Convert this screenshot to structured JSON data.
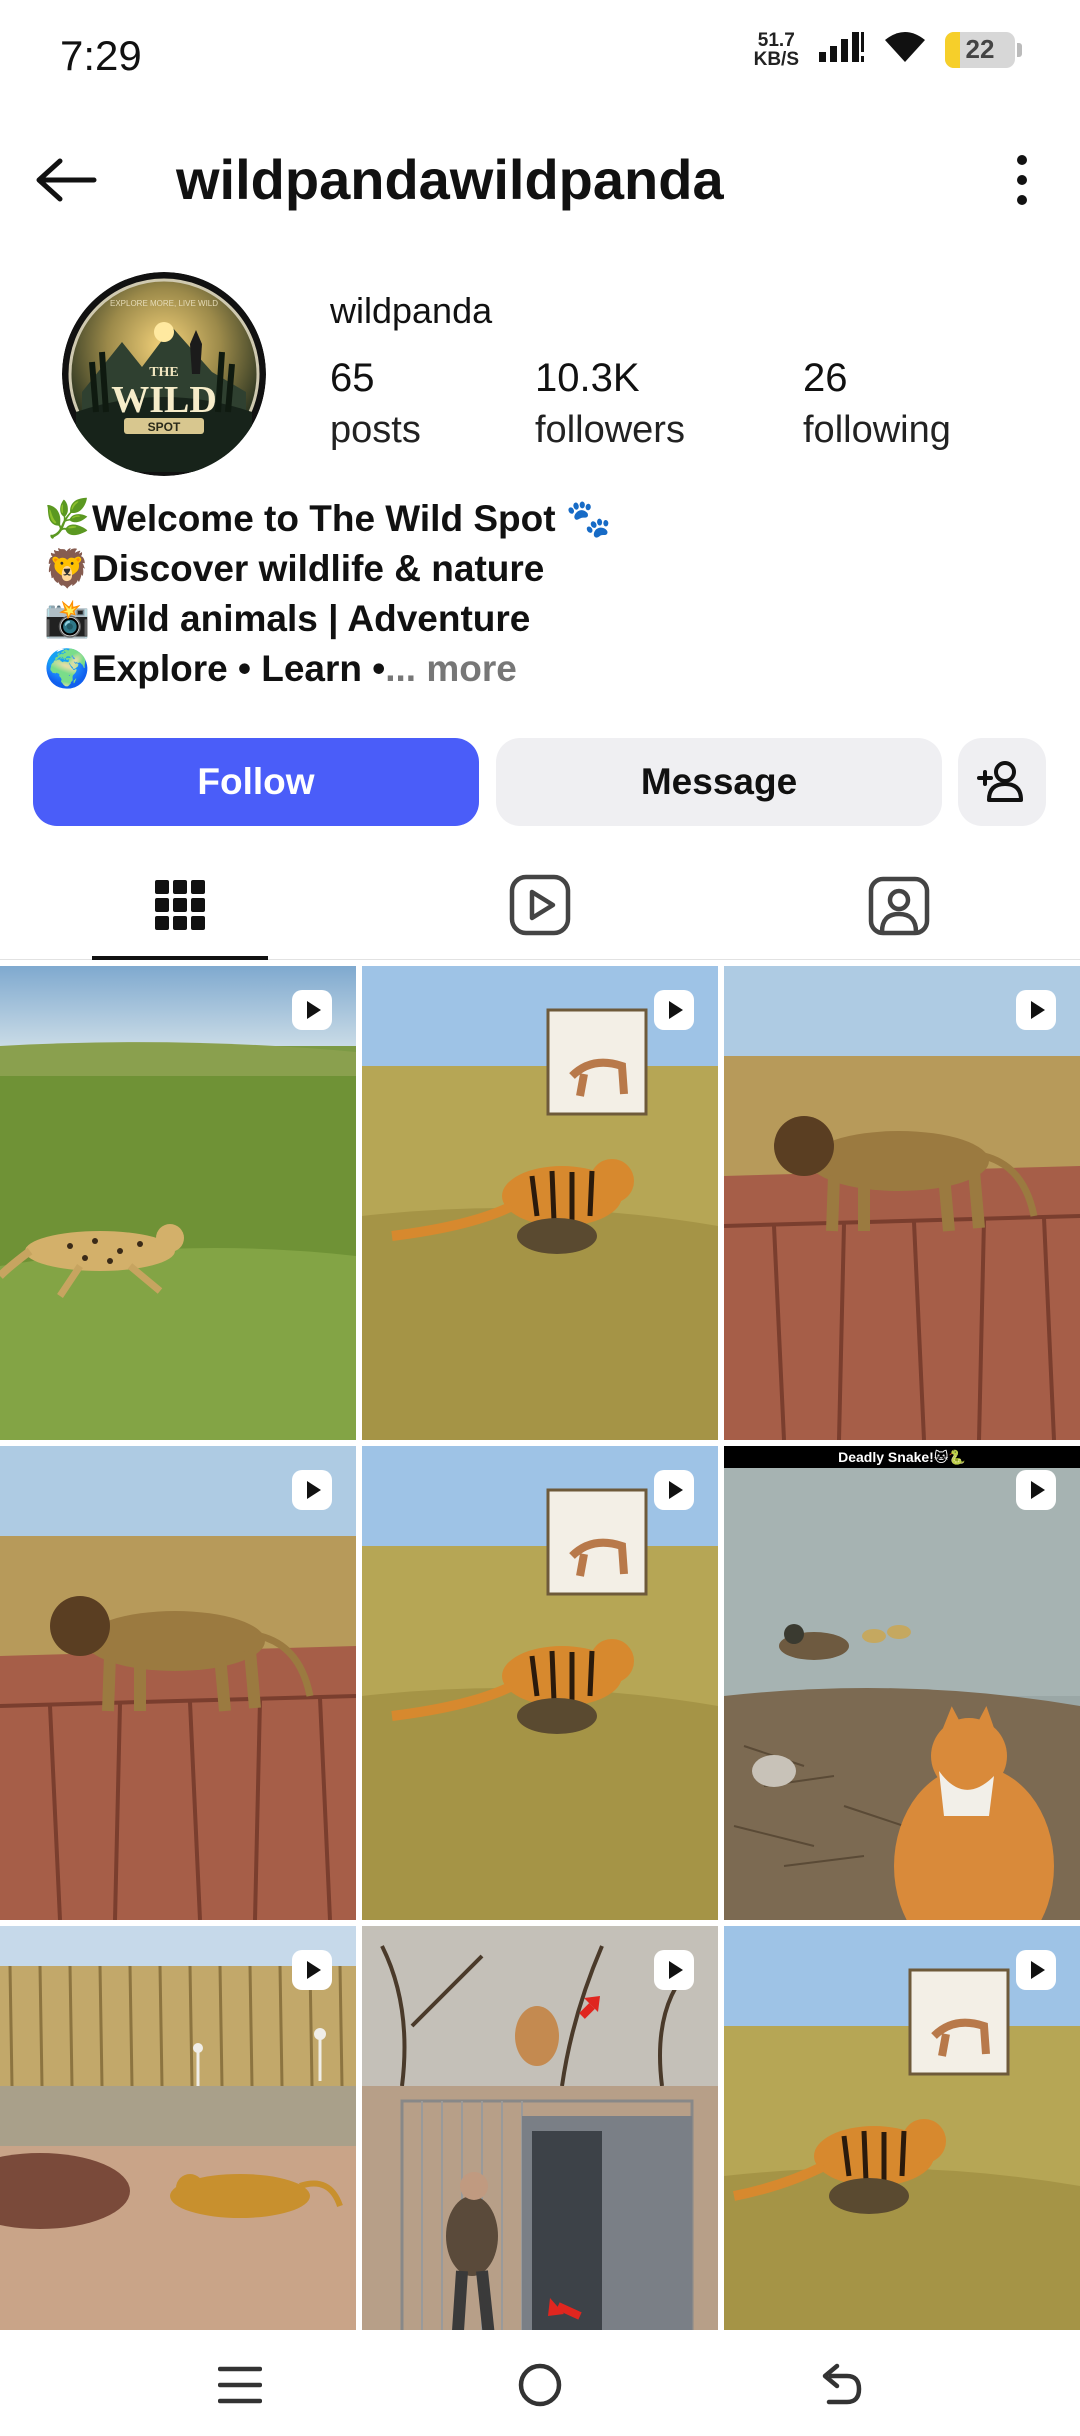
{
  "status_bar": {
    "time": "7:29",
    "net_speed_value": "51.7",
    "net_speed_unit": "KB/S",
    "battery": "22",
    "battery_level": 0.22
  },
  "header": {
    "title": "wildpandawildpanda"
  },
  "profile": {
    "display_name": "wildpanda",
    "avatar_text": {
      "top": "EXPLORE MORE, LIVE WILD",
      "the": "THE",
      "main": "WILD",
      "sub": "SPOT"
    },
    "stats": [
      {
        "value": "65",
        "label": "posts"
      },
      {
        "value": "10.3K",
        "label": "followers"
      },
      {
        "value": "26",
        "label": "following"
      }
    ],
    "bio": [
      {
        "emoji": "🌿",
        "text": "Welcome to The Wild Spot",
        "suffix": " 🐾"
      },
      {
        "emoji": "🦁",
        "text": "Discover wildlife & nature",
        "suffix": ""
      },
      {
        "emoji": "📸",
        "text": "Wild animals | Adventure",
        "suffix": ""
      },
      {
        "emoji": "🌍",
        "text": "Explore • Learn •",
        "suffix": ""
      }
    ],
    "bio_more": "... more"
  },
  "actions": {
    "follow_label": "Follow",
    "message_label": "Message"
  },
  "tabs": [
    {
      "name": "grid-icon",
      "active": true
    },
    {
      "name": "reels-icon",
      "active": false
    },
    {
      "name": "tagged-icon",
      "active": false
    }
  ],
  "grid": {
    "posts": [
      {
        "scene": "cheetah-run"
      },
      {
        "scene": "tiger-antelope-sign"
      },
      {
        "scene": "lion-cliff"
      },
      {
        "scene": "lion-cliff"
      },
      {
        "scene": "tiger-antelope-sign"
      },
      {
        "scene": "cat-ducks",
        "caption": "Deadly Snake!🐱🐍"
      },
      {
        "scene": "hippo-leopard"
      },
      {
        "scene": "lion-cage-trap"
      },
      {
        "scene": "tiger-antelope-sign"
      }
    ]
  },
  "colors": {
    "follow_button": "#4a5df9",
    "secondary_button": "#efeff2",
    "battery": "#f6cf2a"
  }
}
